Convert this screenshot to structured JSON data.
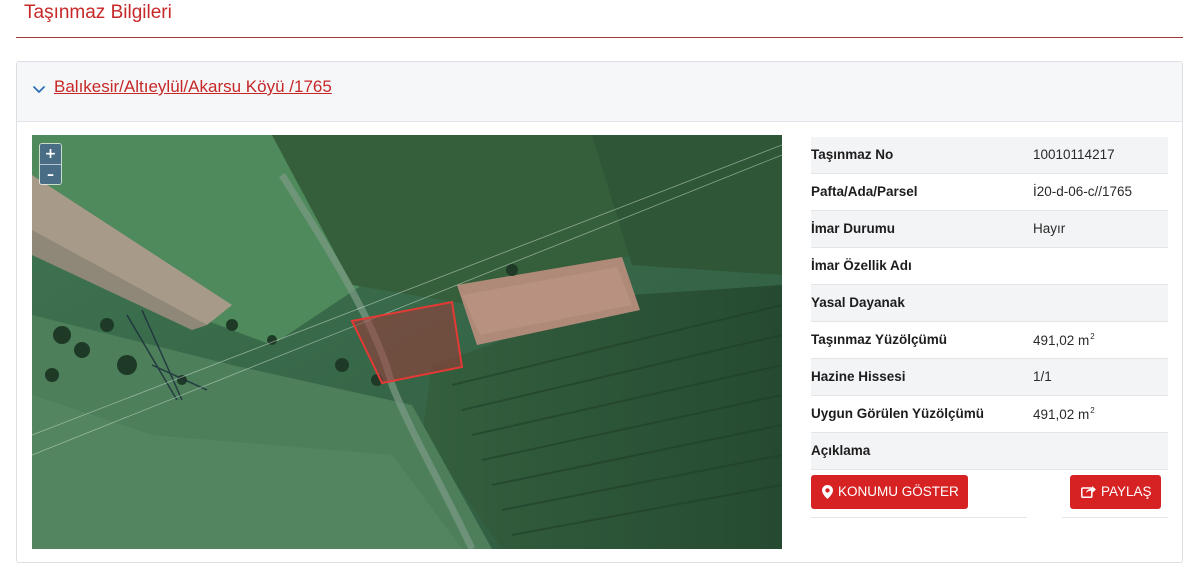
{
  "page": {
    "title": "Taşınmaz Bilgileri"
  },
  "panel": {
    "location_link": "Balıkesir/Altıeylül/Akarsu Köyü /1765"
  },
  "map": {
    "zoom_in": "+",
    "zoom_out": "–"
  },
  "details": [
    {
      "label": "Taşınmaz No",
      "value": "10010114217",
      "unit": ""
    },
    {
      "label": "Pafta/Ada/Parsel",
      "value": "İ20-d-06-c//1765",
      "unit": ""
    },
    {
      "label": "İmar Durumu",
      "value": "Hayır",
      "unit": ""
    },
    {
      "label": "İmar Özellik Adı",
      "value": "",
      "unit": ""
    },
    {
      "label": "Yasal Dayanak",
      "value": "",
      "unit": ""
    },
    {
      "label": "Taşınmaz Yüzölçümü",
      "value": "491,02 m",
      "unit": "2"
    },
    {
      "label": "Hazine Hissesi",
      "value": "1/1",
      "unit": ""
    },
    {
      "label": "Uygun Görülen Yüzölçümü",
      "value": "491,02 m",
      "unit": "2"
    },
    {
      "label": "Açıklama",
      "value": "",
      "unit": ""
    }
  ],
  "actions": {
    "locate_label": "KONUMU GÖSTER",
    "share_label": "PAYLAŞ"
  },
  "colors": {
    "accent": "#c62828",
    "button": "#d62222",
    "parcel_outline": "#e53935"
  },
  "icons": {
    "collapse": "chevron-down-icon",
    "locate": "map-marker-icon",
    "share": "share-icon"
  }
}
